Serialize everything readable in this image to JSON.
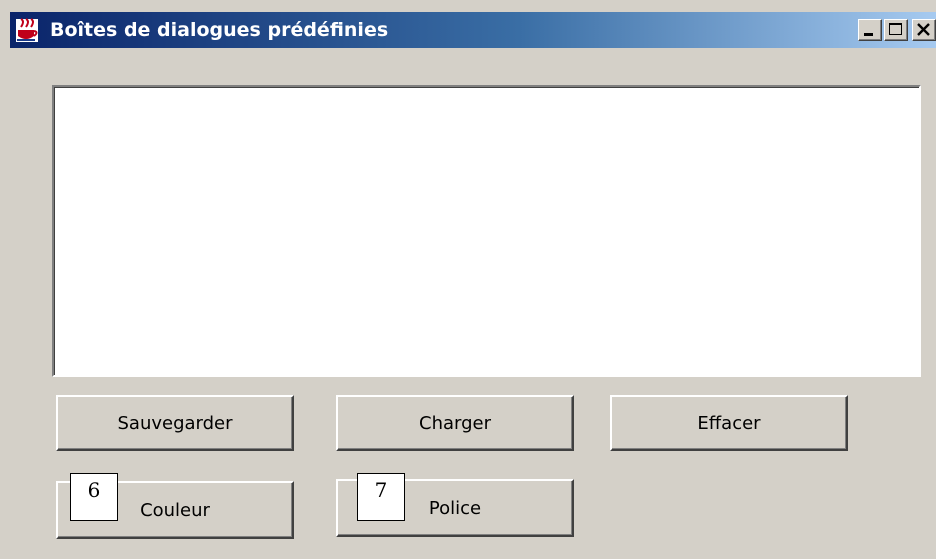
{
  "window": {
    "title": "Boîtes de dialogues prédéfinies",
    "icon": "java-cup-icon",
    "controls": [
      "minimize-icon",
      "maximize-icon",
      "close-icon"
    ]
  },
  "textarea": {
    "value": ""
  },
  "buttons": {
    "save": "Sauvegarder",
    "load": "Charger",
    "clear": "Effacer",
    "color": "Couleur",
    "font": "Police"
  },
  "callouts": {
    "color_number": "6",
    "font_number": "7"
  },
  "colors": {
    "title_start": "#0a246a",
    "title_end": "#a6caf0",
    "face": "#d4d0c8"
  }
}
